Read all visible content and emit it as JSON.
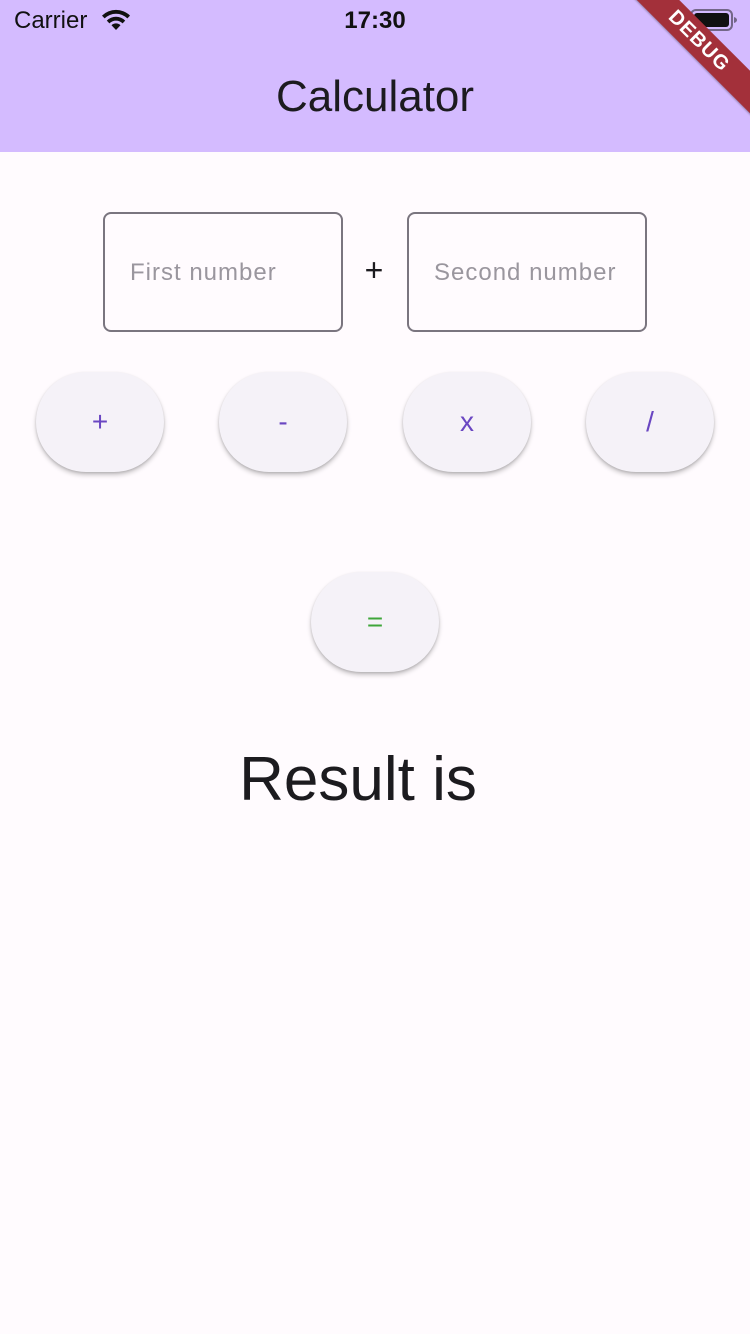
{
  "status_bar": {
    "carrier": "Carrier",
    "time": "17:30",
    "wifi_icon": "wifi-icon",
    "battery_icon": "battery-icon"
  },
  "app_bar": {
    "title": "Calculator",
    "background_color": "#d4bbff"
  },
  "debug_banner": {
    "label": "DEBUG",
    "color": "#a3303a"
  },
  "inputs": {
    "first": {
      "placeholder": "First number",
      "value": ""
    },
    "operator": "+",
    "second": {
      "placeholder": "Second number",
      "value": ""
    }
  },
  "operations": {
    "add": "+",
    "subtract": "-",
    "multiply": "x",
    "divide": "/",
    "equals": "=",
    "accent_color": "#6a47c2",
    "equals_color": "#3ea63a"
  },
  "result": {
    "label": "Result is"
  }
}
